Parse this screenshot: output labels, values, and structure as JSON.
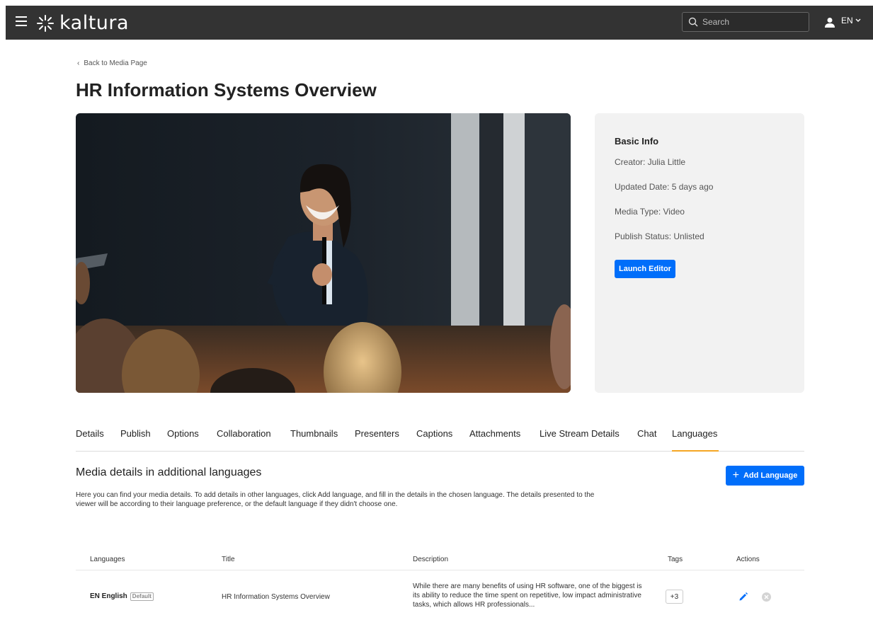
{
  "header": {
    "logo_text": "kaltura",
    "search_placeholder": "Search",
    "language": "EN"
  },
  "back_link": "Back to Media Page",
  "page_title": "HR Information Systems Overview",
  "info": {
    "heading": "Basic Info",
    "creator": "Creator: Julia Little",
    "updated": "Updated Date: 5 days ago",
    "media_type": "Media Type: Video",
    "publish_status": "Publish Status: Unlisted",
    "launch_label": "Launch Editor"
  },
  "tabs": [
    {
      "label": "Details"
    },
    {
      "label": "Publish"
    },
    {
      "label": "Options"
    },
    {
      "label": "Collaboration"
    },
    {
      "label": "Thumbnails"
    },
    {
      "label": "Presenters"
    },
    {
      "label": "Captions"
    },
    {
      "label": "Attachments"
    },
    {
      "label": "Live Stream Details"
    },
    {
      "label": "Chat"
    },
    {
      "label": "Languages"
    }
  ],
  "active_tab": "Languages",
  "section": {
    "title": "Media details in additional languages",
    "add_label": "Add Language",
    "description": "Here you can find your media details. To add details in other languages, click Add language, and fill in the details in the chosen language. The details presented to the viewer will be according to their language preference, or the default language if they didn't choose one."
  },
  "table": {
    "headers": {
      "languages": "Languages",
      "title": "Title",
      "description": "Description",
      "tags": "Tags",
      "actions": "Actions"
    },
    "rows": [
      {
        "language": "EN English",
        "badge": "Default",
        "title": "HR Information Systems Overview",
        "description": "While there are many benefits of using HR software, one of the biggest is its ability to reduce the time spent on repetitive, low impact administrative tasks, which allows HR professionals...",
        "tags": "+3"
      }
    ]
  },
  "colors": {
    "topbar": "#333333",
    "accent": "#006efa",
    "active_tab": "#f5a623",
    "panel": "#f2f2f2"
  }
}
